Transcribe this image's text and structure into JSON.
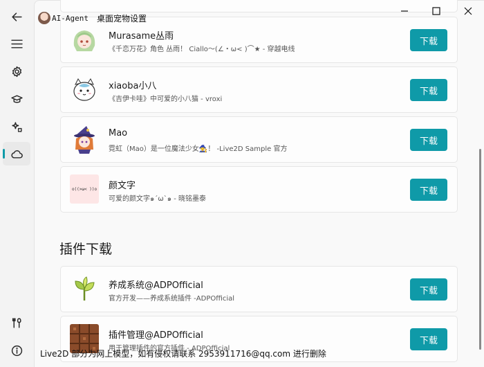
{
  "window": {
    "app_name": "AI-Agent",
    "page_title": "桌面宠物设置",
    "controls": [
      "minimize-icon",
      "maximize-icon",
      "close-icon"
    ]
  },
  "sidebar": {
    "items": [
      {
        "icon": "back-arrow-icon"
      },
      {
        "icon": "menu-icon"
      },
      {
        "icon": "gear-icon"
      },
      {
        "icon": "graduation-cap-icon"
      },
      {
        "icon": "sparkle-icon"
      },
      {
        "icon": "cloud-icon",
        "active": true
      },
      {
        "icon": "tools-icon"
      },
      {
        "icon": "info-icon"
      }
    ]
  },
  "models": [
    {
      "name": "Murasame丛雨",
      "desc": "《千恋万花》角色 丛雨！ Ciallo～(∠・ω< )⌒★    - 穿越电线",
      "button": "下载"
    },
    {
      "name": "xiaoba小八",
      "desc": "《吉伊卡哇》中可爱的小八猫  -  vroxi",
      "button": "下载"
    },
    {
      "name": "Mao",
      "desc": "霓虹（Mao）是一位魔法少女🧙‍♀️！ -Live2D Sample 官方",
      "button": "下载"
    },
    {
      "name": "颜文字",
      "desc": "可爱的颜文字๑´ω`๑   -  晓铭墨泰",
      "thumb_text": "o((>ω< ))o",
      "button": "下载"
    }
  ],
  "plugins_section": {
    "title": "插件下载",
    "items": [
      {
        "name": "养成系统@ADPOfficial",
        "desc": "官方开发——养成系统插件   -ADPOfficial",
        "button": "下载"
      },
      {
        "name": "插件管理@ADPOfficial",
        "desc": "用于管理插件的官方插件   - ADPOfficial",
        "button": "下载"
      }
    ]
  },
  "footer_note": "Live2D 部分为网上模型，如有侵权请联系 2953911716@qq.com 进行删除",
  "colors": {
    "accent": "#0f9aa8",
    "background": "#f3f3f3",
    "card": "#fdfdfd"
  }
}
